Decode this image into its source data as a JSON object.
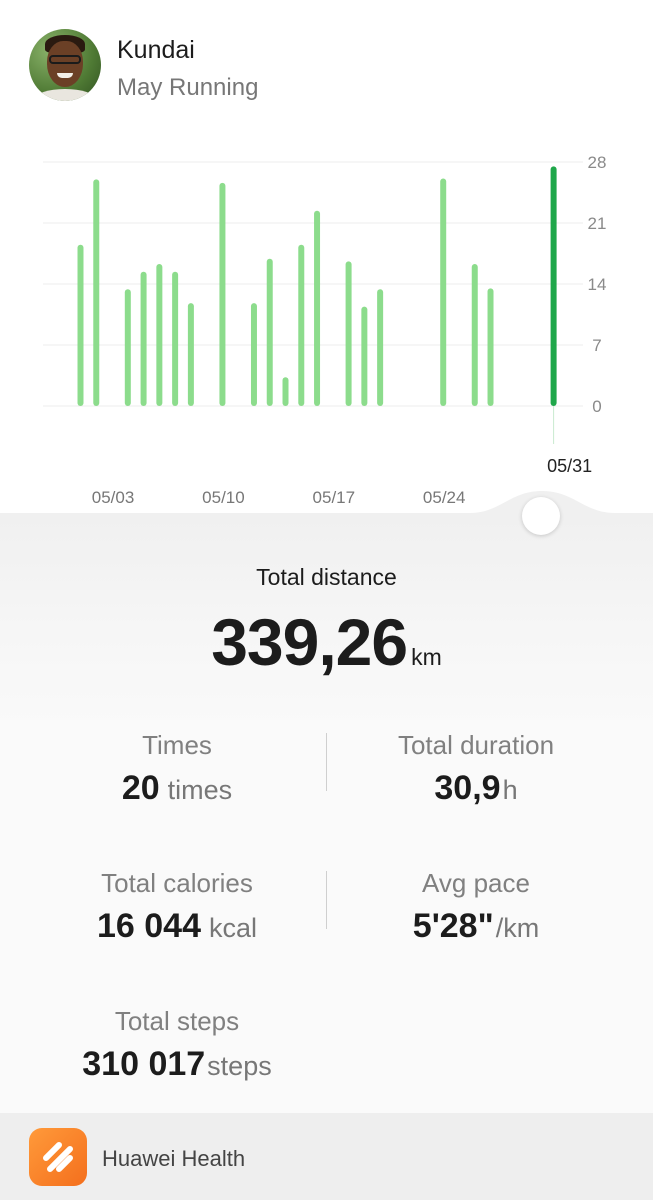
{
  "header": {
    "user_name": "Kundai",
    "subtitle": "May Running"
  },
  "chart_data": {
    "type": "bar",
    "x": [
      "05/01",
      "05/02",
      "05/03",
      "05/04",
      "05/05",
      "05/06",
      "05/07",
      "05/08",
      "05/09",
      "05/10",
      "05/11",
      "05/12",
      "05/13",
      "05/14",
      "05/15",
      "05/16",
      "05/17",
      "05/18",
      "05/19",
      "05/20",
      "05/21",
      "05/22",
      "05/23",
      "05/24",
      "05/25",
      "05/26",
      "05/27",
      "05/28",
      "05/29",
      "05/30",
      "05/31"
    ],
    "values": [
      18.5,
      26,
      0,
      13.4,
      15.4,
      16.3,
      15.4,
      11.8,
      0,
      25.6,
      0,
      11.8,
      16.9,
      3.3,
      18.5,
      22.4,
      0,
      16.6,
      11.4,
      13.4,
      0,
      0,
      0,
      26.1,
      0,
      16.3,
      13.5,
      0,
      0,
      0,
      27.5
    ],
    "y_ticks": [
      "28",
      "21",
      "14",
      "7",
      "0"
    ],
    "ylim": [
      0,
      28
    ],
    "x_tick_labels": [
      "05/03",
      "05/10",
      "05/17",
      "05/24"
    ],
    "selected_label": "05/31",
    "bar_color": "#8cdc8c",
    "selected_color": "#1fa74a",
    "grid": true
  },
  "summary": {
    "total_distance_label": "Total distance",
    "total_distance_value": "339,26",
    "total_distance_unit": "km"
  },
  "stats": {
    "times": {
      "label": "Times",
      "value": "20",
      "unit": "times"
    },
    "duration": {
      "label": "Total duration",
      "value": "30,9",
      "unit": "h"
    },
    "calories": {
      "label": "Total calories",
      "value": "16 044",
      "unit": "kcal"
    },
    "pace": {
      "label": "Avg pace",
      "value": "5'28\"",
      "unit": "/km"
    },
    "steps": {
      "label": "Total steps",
      "value": "310 017",
      "unit": "steps"
    }
  },
  "footer": {
    "app_name": "Huawei Health",
    "app_icon": "huawei-health-icon"
  }
}
